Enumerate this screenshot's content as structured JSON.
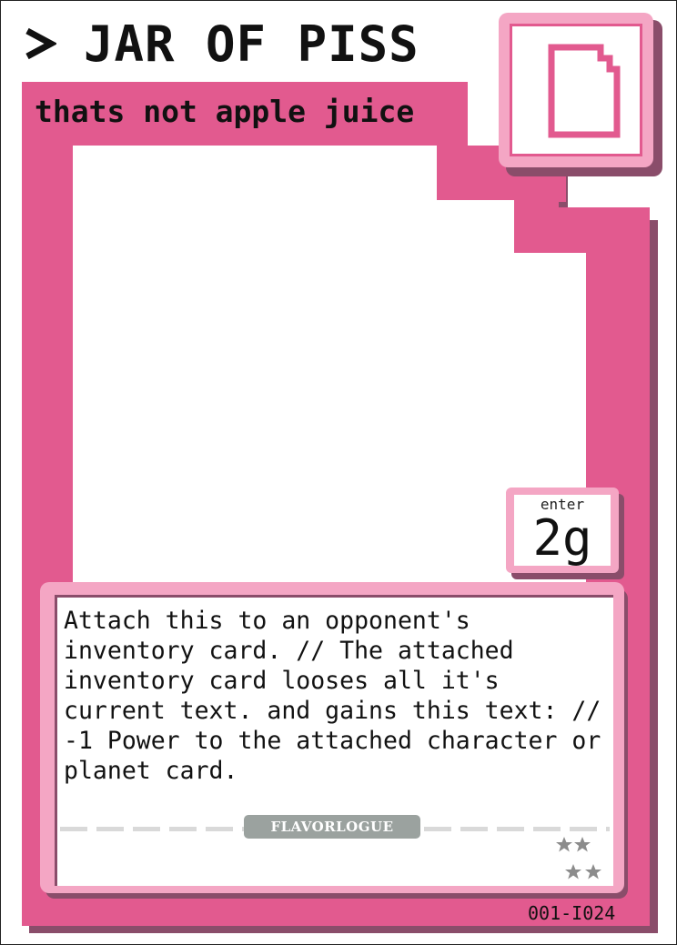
{
  "card": {
    "name": "JAR OF PISS",
    "subtitle": "thats not apple juice",
    "type_icon": "document-icon",
    "cost_label": "enter",
    "cost_value": "2g",
    "rules_text": "Attach this to an opponent's inventory card. // The attached inventory card looses all it's current text. and gains this text: // -1 Power to the attached character or planet card.",
    "flavor_label": "FLAVORLOGUE",
    "rarity_stars": 4,
    "card_code": "001-I024"
  },
  "colors": {
    "accent": "#e25a8f",
    "accent_light": "#f4a6c4",
    "shadow": "#8a4d6a",
    "flavor_badge": "#9ba29f",
    "star": "#8c8c8c"
  }
}
